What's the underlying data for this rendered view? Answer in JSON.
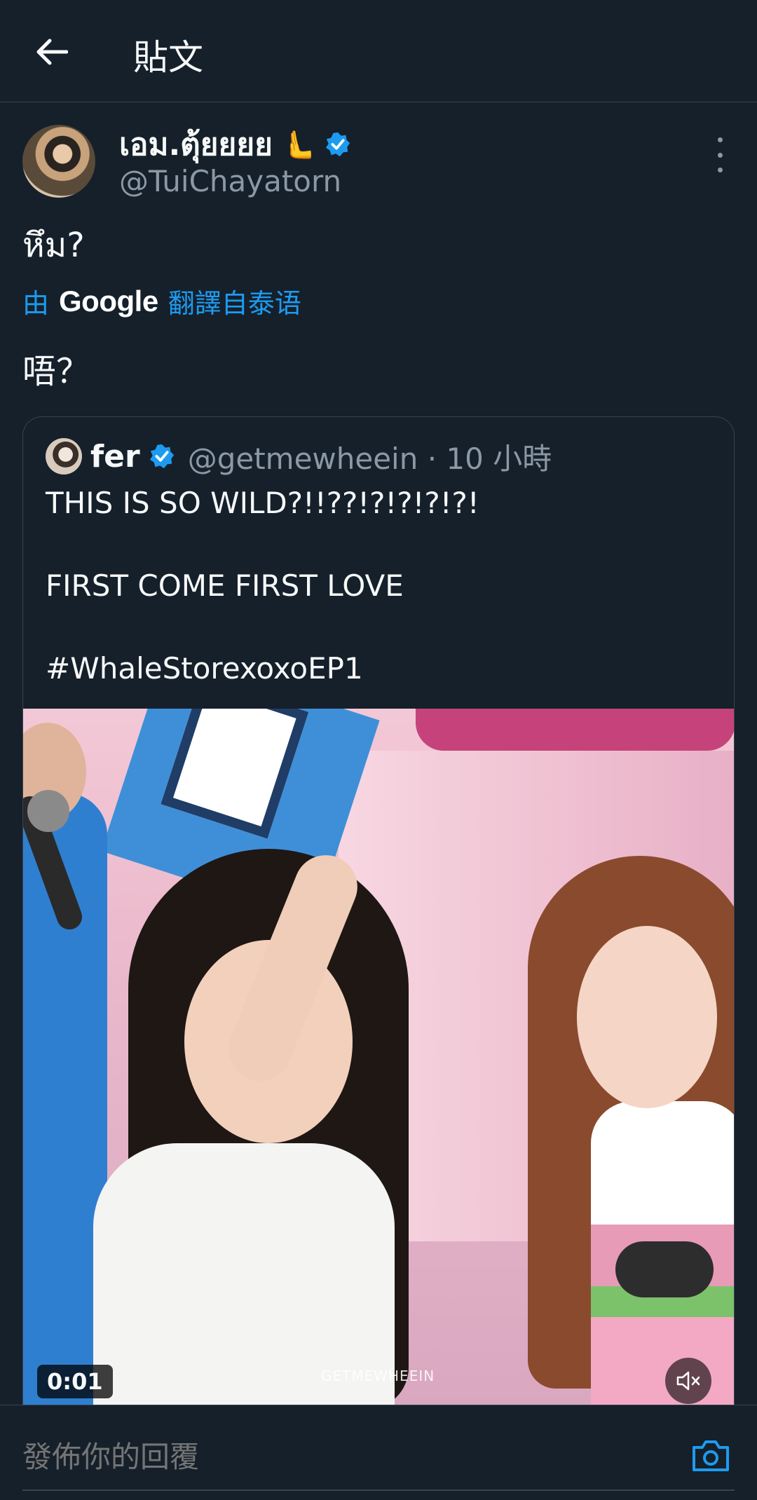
{
  "header": {
    "title": "貼文",
    "back_icon": "arrow-left-icon"
  },
  "tweet": {
    "author_name": "เอม.ตุ้ยยยย",
    "author_emoji": "🫷",
    "author_handle": "@TuiChayatorn",
    "text": "หึม?",
    "translate_prefix": "由",
    "translate_brand": "Google",
    "translate_suffix": "翻譯自泰语",
    "translated_text": "唔？"
  },
  "quote": {
    "name": "fer",
    "handle_meta": "@getmewheein · 10 小時",
    "line1": "THIS IS SO WILD?!!??!?!?!?!?!",
    "line2": "FIRST COME FIRST LOVE",
    "line3": "#WhaleStorexoxoEP1",
    "video": {
      "time": "0:01",
      "watermark": "GETMEWHEEIN"
    }
  },
  "reply": {
    "placeholder": "發佈你的回覆"
  },
  "colors": {
    "background": "#15202b",
    "accent": "#1d9bf0",
    "muted": "#8b98a5",
    "border": "#38444d"
  }
}
